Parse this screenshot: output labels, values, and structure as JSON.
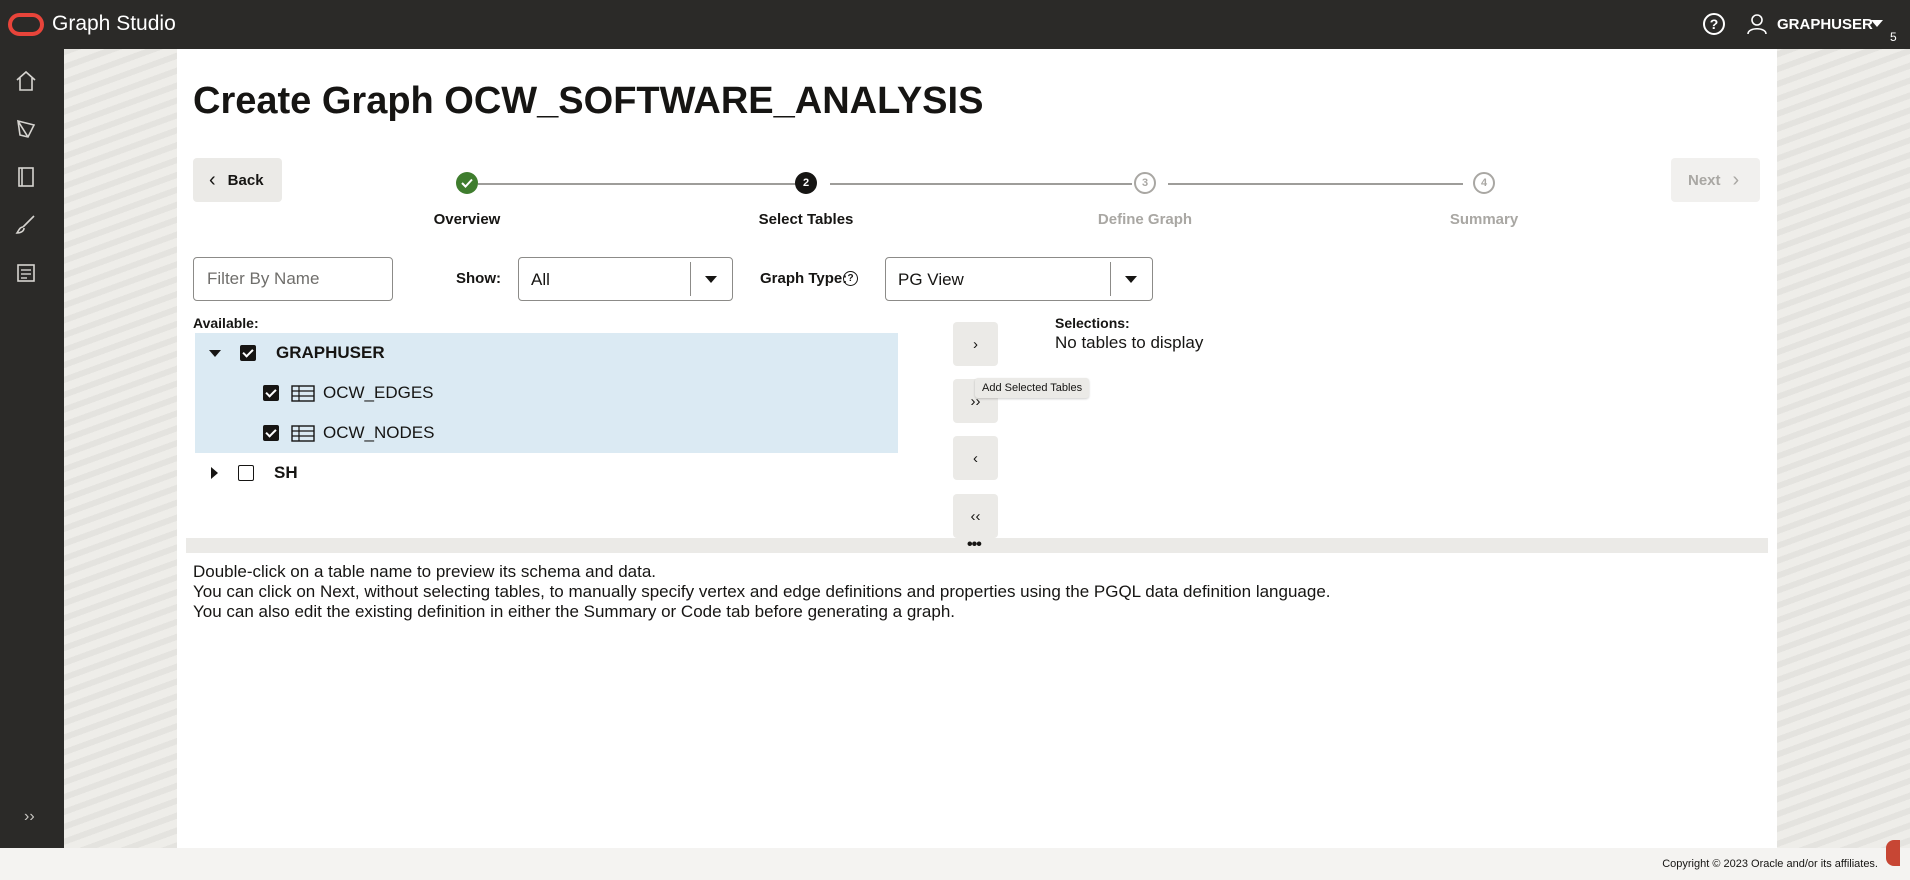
{
  "header": {
    "app_title": "Graph Studio",
    "user_name": "GRAPHUSER",
    "edge_number": "5",
    "icons": [
      "oracle-logo",
      "help-icon",
      "user-icon",
      "chevron-down-icon"
    ]
  },
  "nav": {
    "items": [
      "home-icon",
      "graph-icon",
      "notebook-icon",
      "brush-icon",
      "jobs-icon"
    ],
    "expand_glyph": "››"
  },
  "page": {
    "title": "Create Graph OCW_SOFTWARE_ANALYSIS",
    "back_label": "Back",
    "next_label": "Next"
  },
  "wizard": {
    "steps": [
      {
        "number": "1",
        "label": "Overview",
        "state": "done"
      },
      {
        "number": "2",
        "label": "Select Tables",
        "state": "current"
      },
      {
        "number": "3",
        "label": "Define Graph",
        "state": "future"
      },
      {
        "number": "4",
        "label": "Summary",
        "state": "future"
      }
    ]
  },
  "filters": {
    "filter_placeholder": "Filter By Name",
    "show_label": "Show:",
    "show_value": "All",
    "graph_type_label": "Graph Type:",
    "graph_type_value": "PG View"
  },
  "available": {
    "label": "Available:",
    "schemas": [
      {
        "name": "GRAPHUSER",
        "expanded": true,
        "checked": true,
        "tables": [
          {
            "name": "OCW_EDGES",
            "checked": true
          },
          {
            "name": "OCW_NODES",
            "checked": true
          }
        ]
      },
      {
        "name": "SH",
        "expanded": false,
        "checked": false,
        "tables": []
      }
    ]
  },
  "shuttle": {
    "add_glyph": "›",
    "add_all_glyph": "››",
    "remove_glyph": "‹",
    "remove_all_glyph": "‹‹",
    "tooltip": "Add Selected Tables"
  },
  "selections": {
    "label": "Selections:",
    "empty_text": "No tables to display"
  },
  "splitter": {
    "glyph": "•••"
  },
  "help": {
    "lines": [
      "Double-click on a table name to preview its schema and data.",
      "You can click on Next, without selecting tables, to manually specify vertex and edge definitions and properties using the PGQL data definition language.",
      "You can also edit the existing definition in either the Summary or Code tab before generating a graph."
    ]
  },
  "footer": {
    "copyright": "Copyright © 2023 Oracle and/or its affiliates."
  },
  "colors": {
    "topbar": "#2b2a28",
    "accent_red": "#e8443a",
    "done_green": "#3f7d2e",
    "selected_row": "#dbeaf3"
  }
}
